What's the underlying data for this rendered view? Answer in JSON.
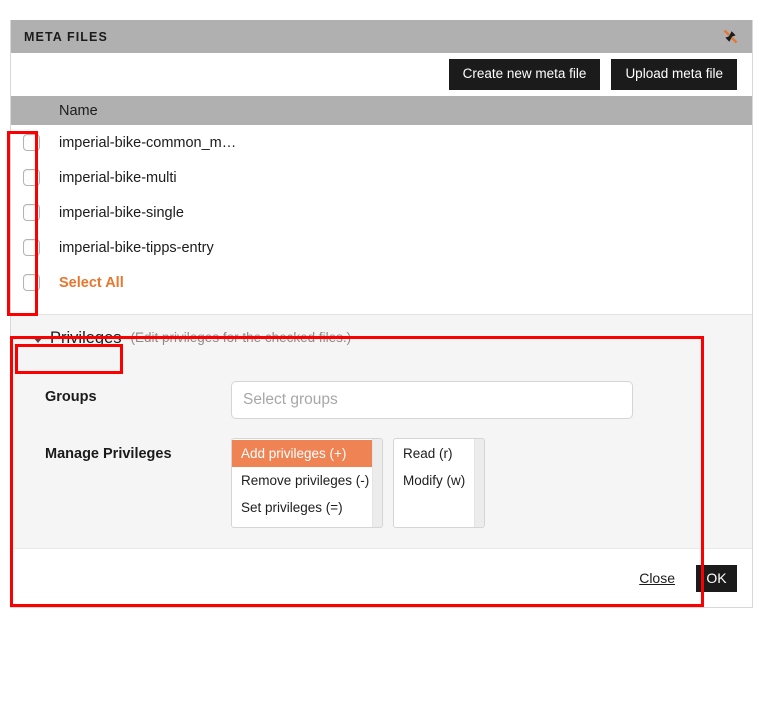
{
  "dialog": {
    "title": "META FILES",
    "collapse_icon": "collapse-diagonal-icon",
    "toolbar": {
      "create_label": "Create new meta file",
      "upload_label": "Upload meta file"
    },
    "table": {
      "columns": [
        "Name"
      ],
      "rows": [
        {
          "name": "imperial-bike-common_m…",
          "checked": false
        },
        {
          "name": "imperial-bike-multi",
          "checked": false
        },
        {
          "name": "imperial-bike-single",
          "checked": false
        },
        {
          "name": "imperial-bike-tipps-entry",
          "checked": false
        }
      ],
      "select_all_label": "Select All",
      "select_all_checked": false
    },
    "privileges": {
      "section_title": "Privileges",
      "section_hint": "(Edit privileges for the checked files.)",
      "caret_icon": "caret-down-icon",
      "expanded": true,
      "groups": {
        "label": "Groups",
        "value": "",
        "placeholder": "Select groups"
      },
      "manage": {
        "label": "Manage Privileges",
        "actions": [
          {
            "label": "Add privileges (+)",
            "selected": true
          },
          {
            "label": "Remove privileges (-)",
            "selected": false
          },
          {
            "label": "Set privileges (=)",
            "selected": false
          }
        ],
        "permissions": [
          {
            "label": "Read (r)",
            "selected": false
          },
          {
            "label": "Modify (w)",
            "selected": false
          }
        ]
      }
    },
    "footer": {
      "close_label": "Close",
      "ok_label": "OK"
    }
  },
  "colors": {
    "titlebar_gray": "#b0b0b0",
    "accent_orange": "#e8762c",
    "selection_orange": "#ef8354",
    "button_dark": "#1b1b1b",
    "panel_gray": "#f5f5f5",
    "annotation_red": "#fb0000"
  }
}
